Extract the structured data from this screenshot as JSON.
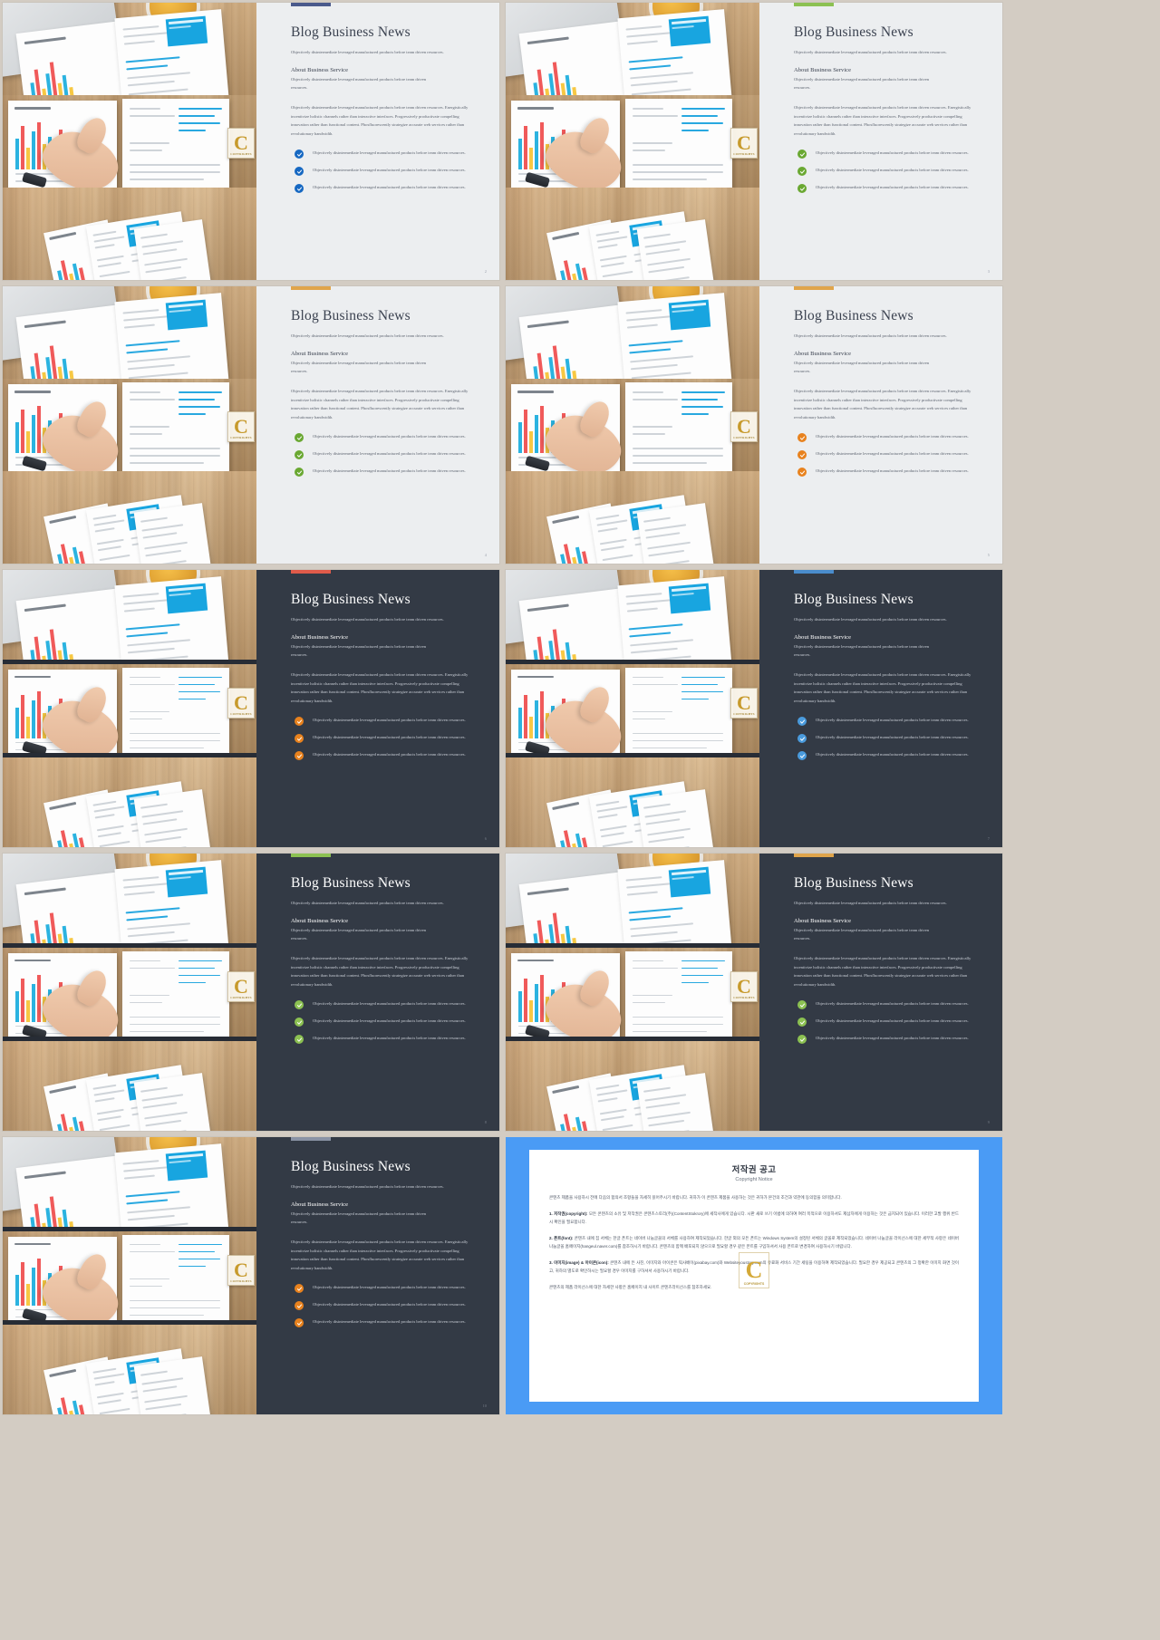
{
  "meta": {
    "background_color": "#d3ccc3",
    "slide_light_bg": "#eceef0",
    "slide_dark_bg": "#333a45"
  },
  "common": {
    "title": "Blog Business News",
    "lede": "Objectively disintermediate leveraged manufactured products before team driven resources.",
    "sub_head": "About Business Service",
    "sub_body": "Objectively disintermediate leveraged manufactured products before team driven resources.",
    "paragraph": "Objectively disintermediate leveraged manufactured products before team driven resources. Energistically incentivize holistic channels rather than interactive interfaces. Progressively productivate compelling innovation rather than functional content. Phosfluorescently strategize accurate web services rather than revolutionary bandwidth.",
    "bullet_text": "Objectively disintermediate leveraged manufactured products before team driven resources.",
    "seal_letter": "C",
    "seal_sub": "COPYRIGHTS"
  },
  "slides": [
    {
      "id": 1,
      "theme": "light",
      "accent": "#4a5a8c",
      "check_color": "#1668c2",
      "page_num": "2"
    },
    {
      "id": 2,
      "theme": "light",
      "accent": "#8cc152",
      "check_color": "#6aa832",
      "page_num": "3"
    },
    {
      "id": 3,
      "theme": "light",
      "accent": "#e0a44a",
      "check_color": "#6aa832",
      "page_num": "4"
    },
    {
      "id": 4,
      "theme": "light",
      "accent": "#e0a44a",
      "check_color": "#e8821e",
      "page_num": "5"
    },
    {
      "id": 5,
      "theme": "dark",
      "accent": "#e05b4a",
      "check_color": "#e8821e",
      "page_num": "6"
    },
    {
      "id": 6,
      "theme": "dark",
      "accent": "#4a8ccc",
      "check_color": "#4a9bdd",
      "page_num": "7"
    },
    {
      "id": 7,
      "theme": "dark",
      "accent": "#8cc152",
      "check_color": "#8cc152",
      "page_num": "8"
    },
    {
      "id": 8,
      "theme": "dark",
      "accent": "#e0a44a",
      "check_color": "#8cc152",
      "page_num": "9"
    },
    {
      "id": 9,
      "theme": "dark",
      "accent": "#8a93a5",
      "check_color": "#e8821e",
      "page_num": "10"
    }
  ],
  "copyright": {
    "frame_color": "#4a9bf5",
    "title": "저작권 공고",
    "subtitle": "Copyright Notice",
    "intro": "콘텐츠 제품을 사용하시 전에 다음의 합의서 조항들을 자세히 읽어주시기 바랍니다. 귀하가 이 콘텐츠 제품을 사용하는 것은 귀하가 본건의 조건과 약관에 동의함을 의미합니다.",
    "items": [
      {
        "num": "1.",
        "label": "저작권(copyright):",
        "body": "모든 콘텐츠의 소유 및 저작권은 콘텐츠스토리(주)(ContentStokrory)에 세작사에게 있습니다. 시판 새로 쓰기 이법에 의하여 여러 목적으로 이용하셔도 제삼자에게 이용하는 것은 금지되어 있습니다. 이러한 고발 행위 반드시 확인을 필요합니다."
      },
      {
        "num": "2.",
        "label": "폰트(font):",
        "body": "콘텐츠 내에 집 서체는 한글 폰트는 네이버 나눔글꼴의 서체를 사용하여 제작되었습니다. 한글 외의 모든 폰트는 Windows System의 설정된 서체의 글꼴로 제작되었습니다. 네이버 나눔글꼴 라이선스에 대한 세부적 사항은 네이버 나눔글꼴 홈페이지(hangeul.naver.com)를 참조하시기 바랍니다. 콘텐츠의 함께 배포되지 않으므로 필요할 경우 같은 폰트를 구입하셔서 사용 폰트로 변경하여 사용하시기 바랍니다."
      },
      {
        "num": "3.",
        "label": "이미지(image) & 아이콘(icon):",
        "body": "콘텐츠 내에 든 사진, 이미지와 아이콘은 픽사베이(pixabay.com)와 Websiteyoustory.com의 유료화 서비스 기간 세팅을 이용하여 제작되었습니다. 필요한 경우 제공되고 콘텐츠의 그 정확한 이미지 화면 것이고, 귀하의 별도로 확인하시는 필요할 경우 이미지를 구하셔서 사용하시기 바랍니다."
      }
    ],
    "footer": "콘텐츠의 제품 라이선스에 대한 자세한 사항은 홈페이지 내 사이트 콘텐츠라이선스를 참조하세요."
  }
}
